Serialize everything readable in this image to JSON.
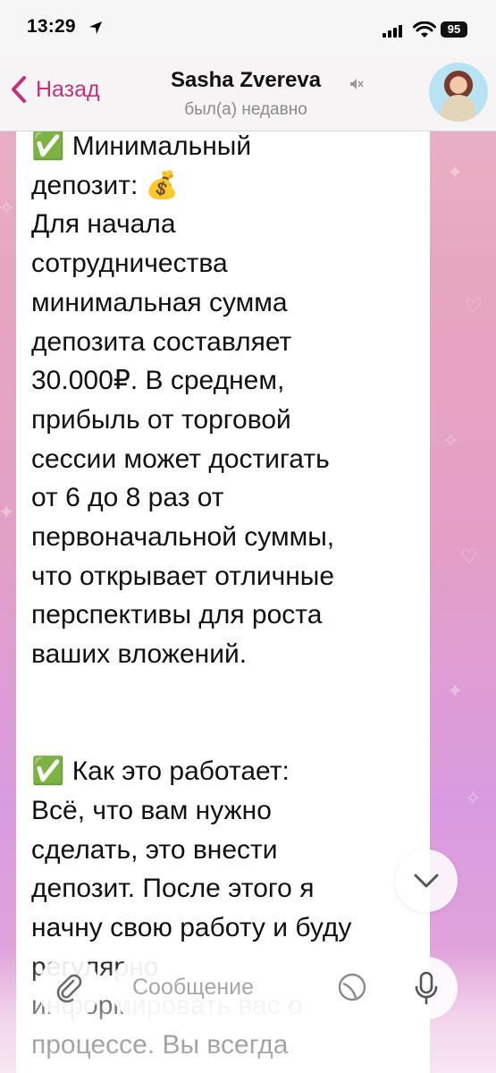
{
  "status_bar": {
    "time": "13:29",
    "battery": "95"
  },
  "header": {
    "back_label": "Назад",
    "title": "Sasha Zvereva",
    "subtitle": "был(а) недавно"
  },
  "message": {
    "text": "✅ Минимальный\nдепозит: 💰\nДля начала\nсотрудничества\nминимальная сумма\nдепозита составляет\n30.000₽. В среднем,\nприбыль от торговой\nсессии может достигать\nот 6 до 8 раз от\nпервоначальной суммы,\nчто открывает отличные\nперспективы для роста\nваших вложений.\n\n\n✅ Как это работает:\nВсё, что вам нужно\nсделать, это внести\nдепозит. После этого я\nначну свою работу и буду\nрегулярно\nинформировать вас о\nпроцессе. Вы всегда"
  },
  "input": {
    "placeholder": "Сообщение"
  },
  "colors": {
    "accent": "#c5307a",
    "bubble": "#ffffff"
  }
}
